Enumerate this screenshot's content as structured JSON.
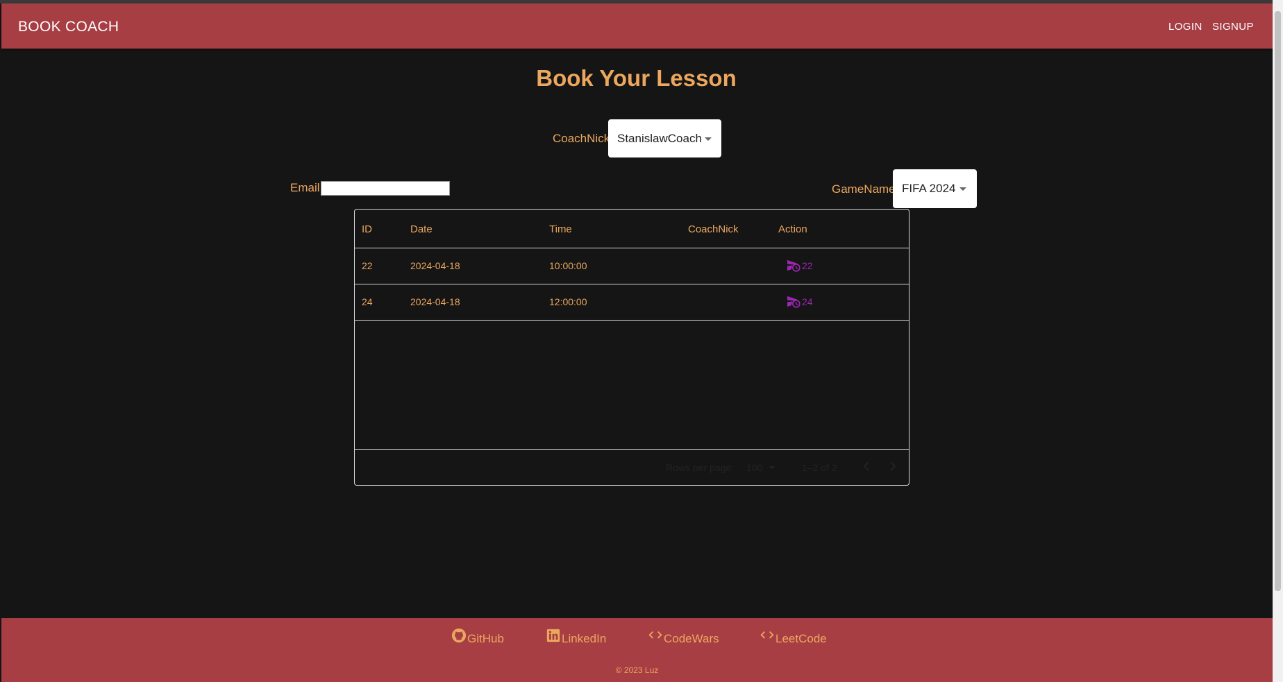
{
  "navbar": {
    "brand": "BOOK COACH",
    "login": "LOGIN",
    "signup": "SIGNUP"
  },
  "page": {
    "title": "Book Your Lesson"
  },
  "form": {
    "coach_label": "CoachNick:",
    "coach_value": "StanislawCoach",
    "email_label": "Email:",
    "email_value": "",
    "game_label": "GameName:",
    "game_value": "FIFA 2024"
  },
  "table": {
    "columns": [
      "ID",
      "Date",
      "Time",
      "CoachNick",
      "Action"
    ],
    "rows": [
      {
        "id": "22",
        "date": "2024-04-18",
        "time": "10:00:00",
        "coach": "",
        "action": "22"
      },
      {
        "id": "24",
        "date": "2024-04-18",
        "time": "12:00:00",
        "coach": "",
        "action": "24"
      }
    ],
    "rows_per_page_label": "Rows per page:",
    "rows_per_page_value": "100",
    "range": "1–2 of 2"
  },
  "footer": {
    "links": [
      {
        "label": "GitHub",
        "icon": "github-icon"
      },
      {
        "label": "LinkedIn",
        "icon": "linkedin-icon"
      },
      {
        "label": "CodeWars",
        "icon": "code-icon"
      },
      {
        "label": "LeetCode",
        "icon": "code-icon"
      }
    ],
    "copyright": "© 2023 Luz"
  },
  "colors": {
    "brand": "#a73e44",
    "accent": "#eca75f",
    "action": "#9b27b0",
    "background": "#151515"
  }
}
